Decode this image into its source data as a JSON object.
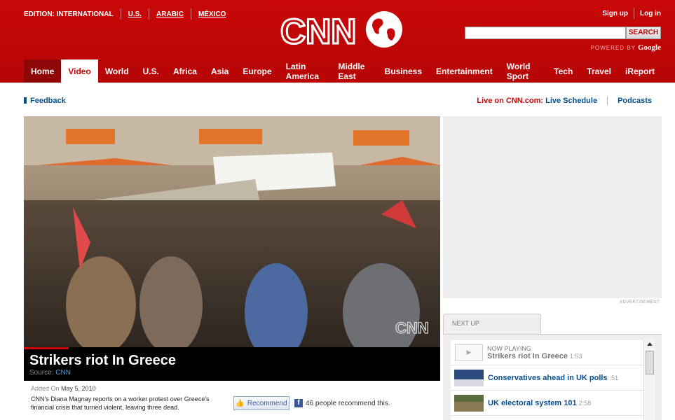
{
  "header": {
    "edition_label": "EDITION: INTERNATIONAL",
    "edition_links": [
      "U.S.",
      "ARABIC",
      "MÉXICO"
    ],
    "sign_up": "Sign up",
    "log_in": "Log in",
    "search_placeholder": "",
    "search_button": "SEARCH",
    "powered_by": "POWERED BY",
    "powered_brand": "Google",
    "logo_text": "CNN"
  },
  "nav": {
    "items": [
      "Home",
      "Video",
      "World",
      "U.S.",
      "Africa",
      "Asia",
      "Europe",
      "Latin America",
      "Middle East",
      "Business",
      "Entertainment",
      "World Sport",
      "Tech",
      "Travel",
      "iReport"
    ],
    "active": "Video"
  },
  "subbar": {
    "feedback": "Feedback",
    "live_prefix": "Live on CNN.com:",
    "live_schedule": "Live Schedule",
    "podcasts": "Podcasts"
  },
  "video": {
    "title": "Strikers riot In Greece",
    "source_label": "Source:",
    "source": "CNN",
    "watermark": "CNN",
    "added_label": "Added On",
    "added_date": "May 5, 2010",
    "description": "CNN's Diana Magnay reports on a worker protest over Greece's financial crisis that turned violent, leaving three dead.",
    "recommend_button": "Recommend",
    "recommend_count": "46 people recommend this."
  },
  "sidebar": {
    "ad_label": "ADVERTISEMENT",
    "next_up_tab": "NEXT UP",
    "now_playing_label": "NOW PLAYING",
    "playlist": [
      {
        "title": "Strikers riot In Greece",
        "duration": "1:53"
      },
      {
        "title": "Conservatives ahead in UK polls",
        "duration": ":51"
      },
      {
        "title": "UK electoral system 101",
        "duration": "2:58"
      }
    ]
  },
  "colors": {
    "brand_red": "#c80808",
    "link_blue": "#064f8e"
  }
}
